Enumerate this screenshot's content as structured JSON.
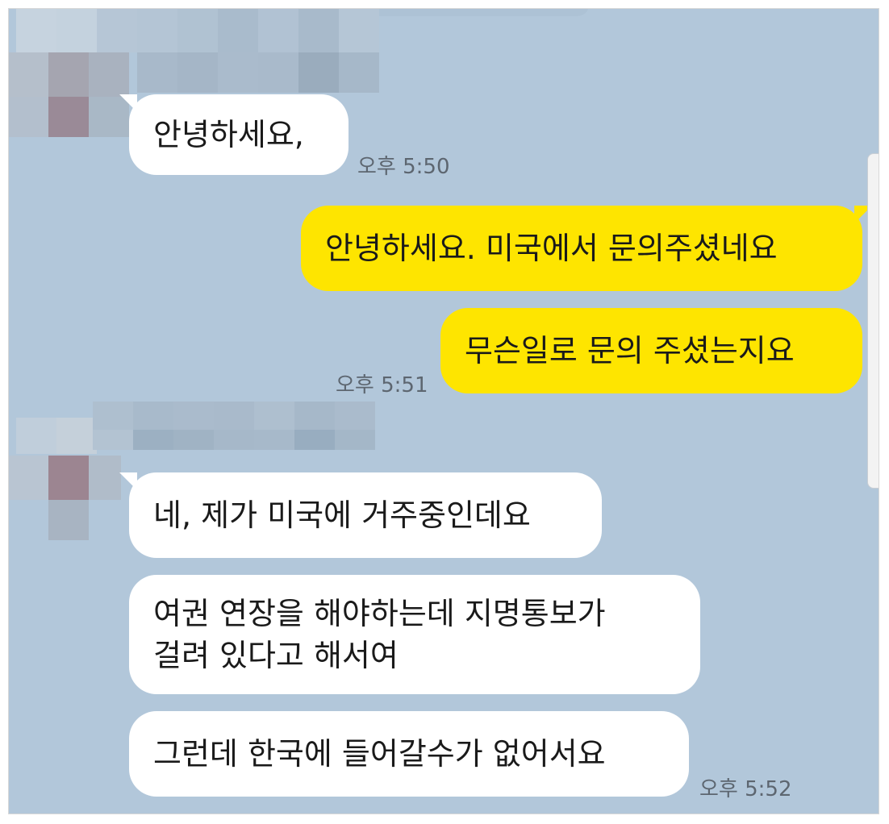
{
  "colors": {
    "chat_background": "#b2c7da",
    "incoming_bubble": "#ffffff",
    "outgoing_bubble": "#fee500",
    "timestamp_text": "#5d6670"
  },
  "messages": [
    {
      "direction": "incoming",
      "text": "안녕하세요,"
    },
    {
      "direction": "outgoing",
      "text": "안녕하세요. 미국에서 문의주셨네요"
    },
    {
      "direction": "outgoing",
      "text": "무슨일로 문의 주셨는지요"
    },
    {
      "direction": "incoming",
      "text": "네, 제가 미국에 거주중인데요"
    },
    {
      "direction": "incoming",
      "lines": [
        "여권 연장을 해야하는데 지명통보가",
        "걸려 있다고 해서여"
      ]
    },
    {
      "direction": "incoming",
      "text": "그런데 한국에 들어갈수가 없어서요"
    }
  ],
  "timestamps": [
    "오후 5:50",
    "오후 5:51",
    "오후 5:52"
  ],
  "icons": {
    "sender_avatar": "pixelated-avatar-icon",
    "sender_name": "pixelated-name"
  }
}
